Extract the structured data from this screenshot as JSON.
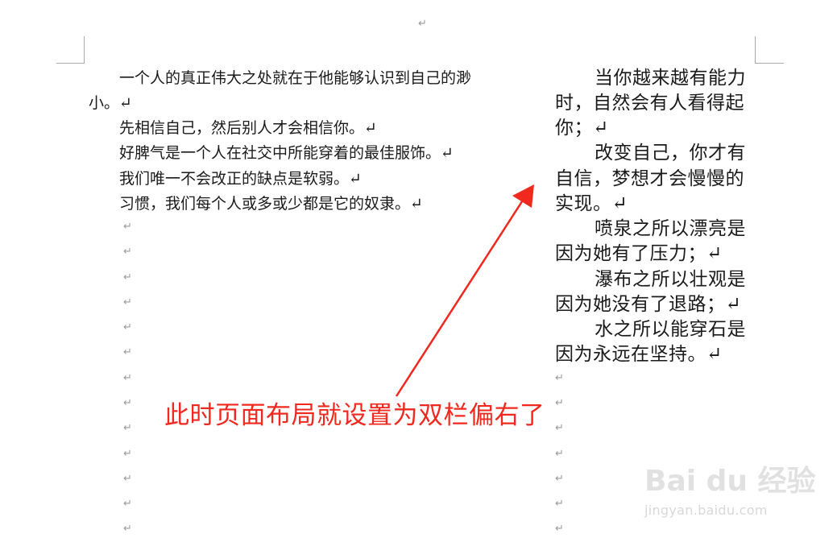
{
  "symbols": {
    "paragraph_mark": "↵"
  },
  "left_column": [
    {
      "text": "一个人的真正伟大之处就在于他能够认识到自己的渺"
    },
    {
      "text": "小。↵"
    },
    {
      "text": "先相信自己，然后别人才会相信你。↵"
    },
    {
      "text": "好脾气是一个人在社交中所能穿着的最佳服饰。↵"
    },
    {
      "text": "我们唯一不会改正的缺点是软弱。↵"
    },
    {
      "text": "习惯，我们每个人或多或少都是它的奴隶。↵"
    }
  ],
  "right_column": [
    {
      "text": "当你越来越有能力"
    },
    {
      "text": "时，自然会有人看得起"
    },
    {
      "text": "你；↵"
    },
    {
      "text": "改变自己，你才有"
    },
    {
      "text": "自信，梦想才会慢慢的"
    },
    {
      "text": "实现。↵"
    },
    {
      "text": "喷泉之所以漂亮是"
    },
    {
      "text": "因为她有了压力；↵"
    },
    {
      "text": "瀑布之所以壮观是"
    },
    {
      "text": "因为她没有了退路；↵"
    },
    {
      "text": "水之所以能穿石是"
    },
    {
      "text": "因为永远在坚持。↵"
    }
  ],
  "annotation": {
    "text": "此时页面布局就设置为双栏偏右了",
    "color": "#f0281e"
  },
  "watermark": {
    "logo_text": "Bai du 经验",
    "url": "jingyan.baidu.com"
  }
}
